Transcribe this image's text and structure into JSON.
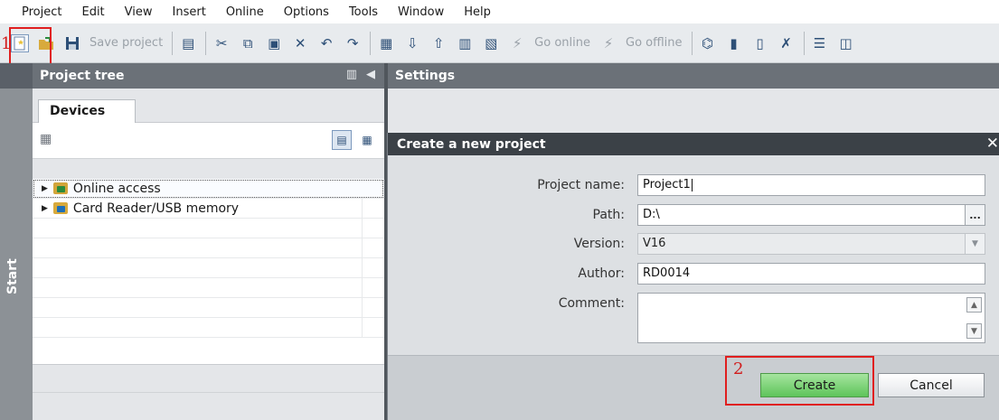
{
  "menubar": {
    "items": [
      "Project",
      "Edit",
      "View",
      "Insert",
      "Online",
      "Options",
      "Tools",
      "Window",
      "Help"
    ]
  },
  "toolbar": {
    "save_project": "Save project",
    "go_online": "Go online",
    "go_offline": "Go offline"
  },
  "annotations": {
    "one": "1",
    "two": "2"
  },
  "sidebar": {
    "start_label": "Start"
  },
  "project_tree": {
    "title": "Project tree",
    "tab_devices": "Devices",
    "items": [
      {
        "label": "Online access"
      },
      {
        "label": "Card Reader/USB memory"
      }
    ]
  },
  "settings": {
    "title": "Settings"
  },
  "dialog": {
    "title": "Create a new project",
    "project_name_label": "Project name:",
    "project_name_value": "Project1",
    "path_label": "Path:",
    "path_value": "D:\\",
    "path_browse": "...",
    "version_label": "Version:",
    "version_value": "V16",
    "author_label": "Author:",
    "author_value": "RD0014",
    "comment_label": "Comment:",
    "comment_value": "",
    "create_button": "Create",
    "cancel_button": "Cancel"
  },
  "colors": {
    "annotation_red": "#e01f1f",
    "create_green": "#5ec45a",
    "panel_header": "#6b7178",
    "dialog_title": "#3b4147"
  }
}
